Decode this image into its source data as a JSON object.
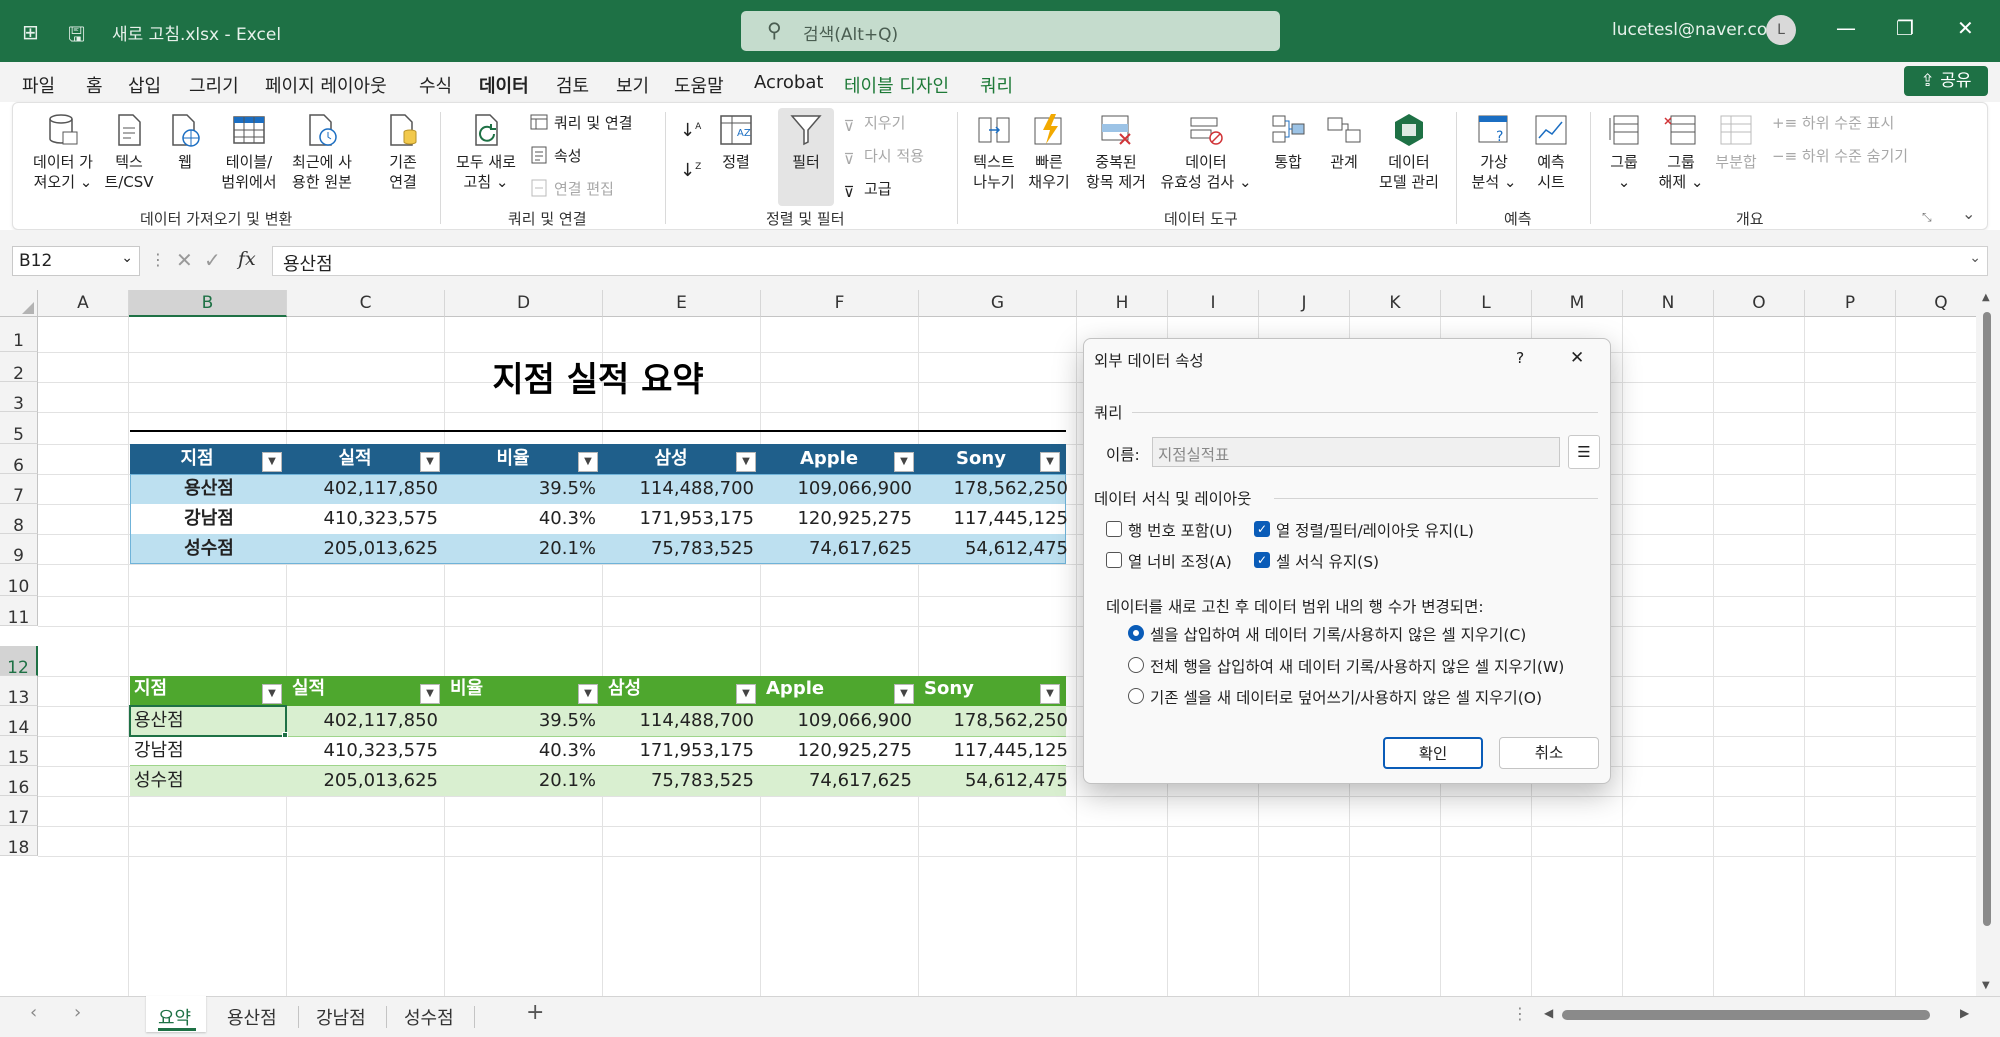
{
  "app": {
    "title": "새로 고침.xlsx  -  Excel",
    "search_placeholder": "검색(Alt+Q)",
    "user": "lucetesl@naver.com",
    "avatar": "L",
    "share_label": "공유"
  },
  "menu": [
    "파일",
    "홈",
    "삽입",
    "그리기",
    "페이지 레이아웃",
    "수식",
    "데이터",
    "검토",
    "보기",
    "도움말",
    "Acrobat",
    "테이블 디자인",
    "쿼리"
  ],
  "ribbon": {
    "get_data": "데이터 가\n져오기 ⌄",
    "text_csv": "텍스\n트/CSV",
    "web": "웹",
    "from_table": "테이블/\n범위에서",
    "recent": "최근에 사\n용한 원본",
    "existing": "기존\n연결",
    "group1": "데이터 가져오기 및 변환",
    "refresh_all": "모두 새로\n고침 ⌄",
    "queries_connections": "쿼리 및 연결",
    "properties": "속성",
    "edit_links": "연결 편집",
    "group2": "쿼리 및 연결",
    "sort": "정렬",
    "filter": "필터",
    "clear": "지우기",
    "reapply": "다시 적용",
    "advanced": "고급",
    "group3": "정렬 및 필터",
    "text_to_columns": "텍스트\n나누기",
    "flash_fill": "빠른\n채우기",
    "remove_duplicates": "중복된\n항목 제거",
    "data_validation": "데이터\n유효성 검사 ⌄",
    "consolidate": "통합",
    "relationships": "관계",
    "data_model": "데이터\n모델 관리",
    "group4": "데이터 도구",
    "what_if": "가상\n분석 ⌄",
    "forecast_sheet": "예측\n시트",
    "group5": "예측",
    "group_btn": "그룹\n⌄",
    "ungroup": "그룹\n해제 ⌄",
    "subtotal": "부분합",
    "show_detail": "하위 수준 표시",
    "hide_detail": "하위 수준 숨기기",
    "group6": "개요"
  },
  "formula_bar": {
    "name_box": "B12",
    "formula": "용산점"
  },
  "columns": [
    "A",
    "B",
    "C",
    "D",
    "E",
    "F",
    "G",
    "H",
    "I",
    "J",
    "K",
    "L",
    "M",
    "N",
    "O",
    "P",
    "Q"
  ],
  "rows": [
    "1",
    "2",
    "3",
    "5",
    "6",
    "7",
    "8",
    "9",
    "10",
    "11",
    "12",
    "13",
    "14",
    "15",
    "16",
    "17",
    "18"
  ],
  "sheet_title": "지점 실적 요약",
  "table1": {
    "headers": [
      "지점",
      "실적",
      "비율",
      "삼성",
      "Apple",
      "Sony"
    ],
    "rows": [
      [
        "용산점",
        "402,117,850",
        "39.5%",
        "114,488,700",
        "109,066,900",
        "178,562,250"
      ],
      [
        "강남점",
        "410,323,575",
        "40.3%",
        "171,953,175",
        "120,925,275",
        "117,445,125"
      ],
      [
        "성수점",
        "205,013,625",
        "20.1%",
        "75,783,525",
        "74,617,625",
        "54,612,475"
      ]
    ]
  },
  "table2": {
    "headers": [
      "지점",
      "실적",
      "비율",
      "삼성",
      "Apple",
      "Sony"
    ],
    "rows": [
      [
        "용산점",
        "402,117,850",
        "39.5%",
        "114,488,700",
        "109,066,900",
        "178,562,250"
      ],
      [
        "강남점",
        "410,323,575",
        "40.3%",
        "171,953,175",
        "120,925,275",
        "117,445,125"
      ],
      [
        "성수점",
        "205,013,625",
        "20.1%",
        "75,783,525",
        "74,617,625",
        "54,612,475"
      ]
    ]
  },
  "sheets": [
    "요약",
    "용산점",
    "강남점",
    "성수점"
  ],
  "dialog": {
    "title": "외부 데이터 속성",
    "help": "?",
    "close": "✕",
    "query_section": "쿼리",
    "name_label": "이름:",
    "name_value": "지점실적표",
    "format_section": "데이터 서식 및 레이아웃",
    "include_row_numbers": "행 번호 포함(U)",
    "preserve_sort": "열 정렬/필터/레이아웃 유지(L)",
    "adjust_width": "열 너비 조정(A)",
    "preserve_format": "셀 서식 유지(S)",
    "refresh_label": "데이터를 새로 고친 후 데이터 범위 내의 행 수가  변경되면:",
    "opt1": "셀을 삽입하여 새 데이터 기록/사용하지 않은 셀 지우기(C)",
    "opt2": "전체 행을 삽입하여 새 데이터 기록/사용하지 않은 셀 지우기(W)",
    "opt3": "기존 셀을 새 데이터로 덮어쓰기/사용하지 않은 셀 지우기(O)",
    "ok": "확인",
    "cancel": "취소"
  },
  "colors": {
    "excel_green": "#1e7145",
    "table1_header": "#1f5f8b",
    "table1_band": "#bde0f0",
    "table2_header": "#4ea72e",
    "table2_band": "#d9efd0"
  }
}
